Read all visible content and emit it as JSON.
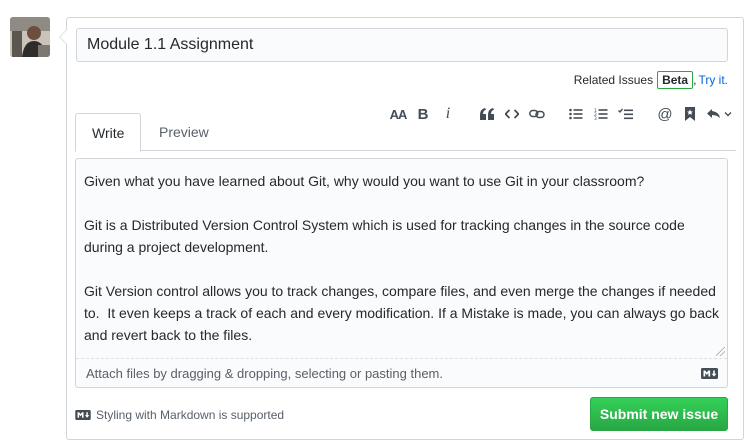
{
  "issue_form": {
    "title_value": "Module 1.1 Assignment",
    "related_issues_label": "Related Issues",
    "beta_badge": "Beta",
    "try_it_link": "Try it.",
    "tabs": [
      {
        "label": "Write"
      },
      {
        "label": "Preview"
      }
    ],
    "toolbar": {
      "header_label": "AA",
      "bold_label": "B",
      "italic_label": "i",
      "mention_label": "@",
      "icons": [
        "text-size-icon",
        "bold-icon",
        "italic-icon",
        "quote-icon",
        "code-icon",
        "link-icon",
        "unordered-list-icon",
        "ordered-list-icon",
        "task-list-icon",
        "mention-icon",
        "saved-replies-icon",
        "reply-icon"
      ]
    },
    "body_text": "Given what you have learned about Git, why would you want to use Git in your classroom?\n\nGit is a Distributed Version Control System which is used for tracking changes in the source code during a project development.\n\nGit Version control allows you to track changes, compare files, and even merge the changes if needed to.  It even keeps a track of each and every modification. If a Mistake is made, you can always go back and revert back to the files.",
    "attach_hint": "Attach files by dragging & dropping, selecting or pasting them.",
    "markdown_note": "Styling with Markdown is supported",
    "submit_label": "Submit new issue"
  },
  "colors": {
    "submit_green": "#28a745",
    "link_blue": "#0366d6",
    "border": "#d1d5da"
  }
}
